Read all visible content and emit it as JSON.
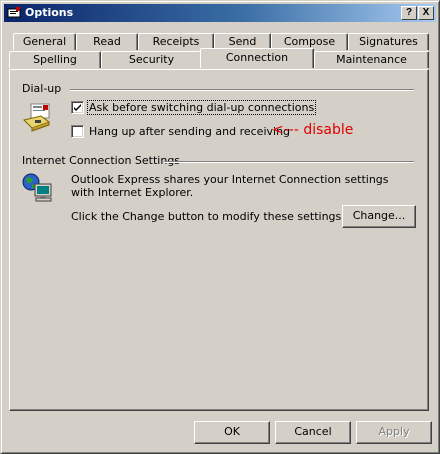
{
  "window": {
    "title": "Options"
  },
  "titlebar": {
    "help_label": "?",
    "close_label": "X"
  },
  "tabs_back": [
    "General",
    "Read",
    "Receipts",
    "Send",
    "Compose",
    "Signatures"
  ],
  "tabs_front": [
    "Spelling",
    "Security",
    "Connection",
    "Maintenance"
  ],
  "active_tab": "Connection",
  "dialup": {
    "group_label": "Dial-up",
    "ask_label": "Ask before switching dial-up connections",
    "ask_checked": true,
    "hangup_label": "Hang up after sending and receiving",
    "hangup_checked": false,
    "annotation": "<--- disable"
  },
  "internet": {
    "group_label": "Internet Connection Settings",
    "description": "Outlook Express shares your Internet Connection settings with Internet Explorer.",
    "change_hint": "Click the Change button to modify these settings.",
    "change_label": "Change..."
  },
  "footer": {
    "ok_label": "OK",
    "cancel_label": "Cancel",
    "apply_label": "Apply"
  },
  "colors": {
    "titlebar_start": "#0a246a",
    "titlebar_end": "#a6caf0",
    "annotation": "#e00000"
  }
}
